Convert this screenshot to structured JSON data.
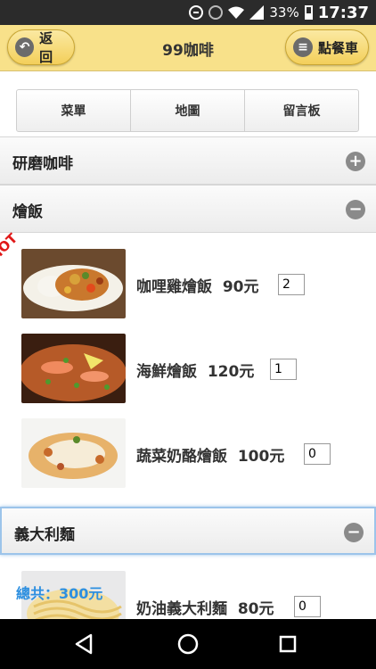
{
  "statusbar": {
    "battery": "33%",
    "time": "17:37"
  },
  "header": {
    "back_label": "返回",
    "title": "99咖啡",
    "cart_label": "點餐車"
  },
  "nav": {
    "tabs": [
      "菜單",
      "地圖",
      "留言板"
    ]
  },
  "categories": [
    {
      "label": "研磨咖啡",
      "state": "+"
    },
    {
      "label": "燴飯",
      "state": "−"
    },
    {
      "label": "義大利麵",
      "state": "−"
    }
  ],
  "items": [
    {
      "name": "咖哩雞燴飯",
      "price": "90元",
      "qty": "2"
    },
    {
      "name": "海鮮燴飯",
      "price": "120元",
      "qty": "1"
    },
    {
      "name": "蔬菜奶酪燴飯",
      "price": "100元",
      "qty": "0"
    },
    {
      "name": "奶油義大利麵",
      "price": "80元",
      "qty": "0"
    }
  ],
  "badges": {
    "hot": "HOT"
  },
  "summary": {
    "total": "總共：300元"
  }
}
